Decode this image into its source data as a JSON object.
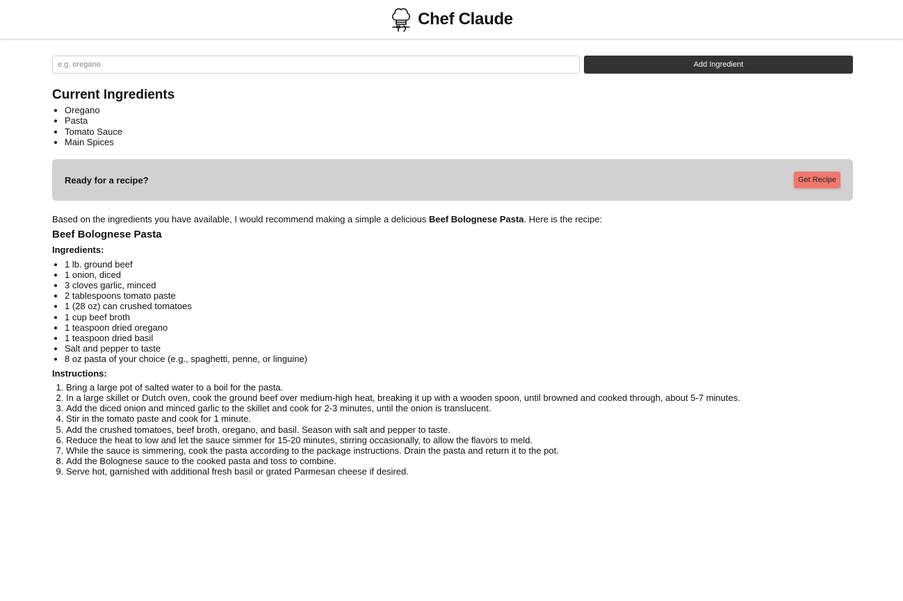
{
  "header": {
    "title": "Chef Claude",
    "logo_icon": "chef-hat-icon"
  },
  "form": {
    "placeholder": "e.g. oregano",
    "value": "",
    "add_label": "Add Ingredient"
  },
  "ingredients_section": {
    "title": "Current Ingredients",
    "items": [
      "Oregano",
      "Pasta",
      "Tomato Sauce",
      "Main Spices"
    ]
  },
  "cta": {
    "heading": "Ready for a recipe?",
    "button_label": "Get Recipe",
    "button_color": "#f1786f"
  },
  "recipe": {
    "intro_before": "Based on the ingredients you have available, I would recommend making a simple a delicious ",
    "intro_bold": "Beef Bolognese Pasta",
    "intro_after": ". Here is the recipe:",
    "title": "Beef Bolognese Pasta",
    "ingredients_label": "Ingredients:",
    "ingredients": [
      "1 lb. ground beef",
      "1 onion, diced",
      "3 cloves garlic, minced",
      "2 tablespoons tomato paste",
      "1 (28 oz) can crushed tomatoes",
      "1 cup beef broth",
      "1 teaspoon dried oregano",
      "1 teaspoon dried basil",
      "Salt and pepper to taste",
      "8 oz pasta of your choice (e.g., spaghetti, penne, or linguine)"
    ],
    "instructions_label": "Instructions:",
    "instructions": [
      "Bring a large pot of salted water to a boil for the pasta.",
      "In a large skillet or Dutch oven, cook the ground beef over medium-high heat, breaking it up with a wooden spoon, until browned and cooked through, about 5-7 minutes.",
      "Add the diced onion and minced garlic to the skillet and cook for 2-3 minutes, until the onion is translucent.",
      "Stir in the tomato paste and cook for 1 minute.",
      "Add the crushed tomatoes, beef broth, oregano, and basil. Season with salt and pepper to taste.",
      "Reduce the heat to low and let the sauce simmer for 15-20 minutes, stirring occasionally, to allow the flavors to meld.",
      "While the sauce is simmering, cook the pasta according to the package instructions. Drain the pasta and return it to the pot.",
      "Add the Bolognese sauce to the cooked pasta and toss to combine.",
      "Serve hot, garnished with additional fresh basil or grated Parmesan cheese if desired."
    ]
  }
}
